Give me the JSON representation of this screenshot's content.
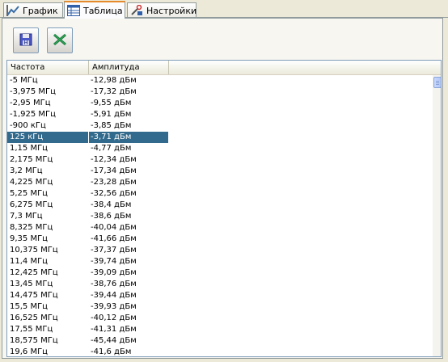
{
  "tabs": [
    {
      "label": "График",
      "icon": "chart-icon",
      "active": false
    },
    {
      "label": "Таблица",
      "icon": "table-icon",
      "active": true
    },
    {
      "label": "Настройки",
      "icon": "settings-icon",
      "active": false
    }
  ],
  "toolbar": {
    "save_icon": "save-floppy-icon",
    "excel_icon": "excel-export-icon"
  },
  "table": {
    "columns": [
      "Частота",
      "Амплитуда"
    ],
    "selected_index": 5,
    "rows": [
      [
        "-5 МГц",
        "-12,98 дБм"
      ],
      [
        "-3,975 МГц",
        "-17,32 дБм"
      ],
      [
        "-2,95 МГц",
        "-9,55 дБм"
      ],
      [
        "-1,925 МГц",
        "-5,91 дБм"
      ],
      [
        "-900 кГц",
        "-3,85 дБм"
      ],
      [
        "125 кГц",
        "-3,71 дБм"
      ],
      [
        "1,15 МГц",
        "-4,77 дБм"
      ],
      [
        "2,175 МГц",
        "-12,34 дБм"
      ],
      [
        "3,2 МГц",
        "-17,34 дБм"
      ],
      [
        "4,225 МГц",
        "-23,28 дБм"
      ],
      [
        "5,25 МГц",
        "-32,56 дБм"
      ],
      [
        "6,275 МГц",
        "-38,4 дБм"
      ],
      [
        "7,3 МГц",
        "-38,6 дБм"
      ],
      [
        "8,325 МГц",
        "-40,04 дБм"
      ],
      [
        "9,35 МГц",
        "-41,66 дБм"
      ],
      [
        "10,375 МГц",
        "-37,37 дБм"
      ],
      [
        "11,4 МГц",
        "-39,74 дБм"
      ],
      [
        "12,425 МГц",
        "-39,09 дБм"
      ],
      [
        "13,45 МГц",
        "-38,76 дБм"
      ],
      [
        "14,475 МГц",
        "-39,44 дБм"
      ],
      [
        "15,5 МГц",
        "-39,93 дБм"
      ],
      [
        "16,525 МГц",
        "-40,12 дБм"
      ],
      [
        "17,55 МГц",
        "-41,31 дБм"
      ],
      [
        "18,575 МГц",
        "-45,44 дБм"
      ],
      [
        "19,6 МГц",
        "-41,6 дБм"
      ]
    ]
  },
  "colors": {
    "selection": "#316a8c",
    "tab_highlight": "#e68b2c"
  }
}
